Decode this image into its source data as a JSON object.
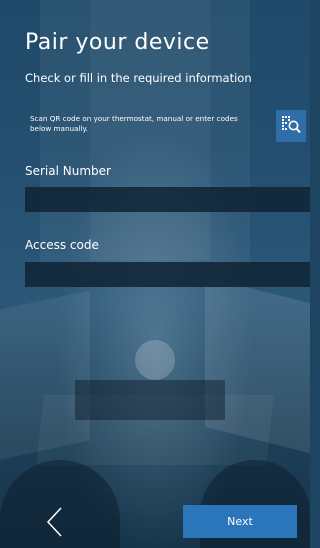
{
  "page": {
    "title": "Pair your device",
    "subtitle": "Check or fill in the required information",
    "scan_instructions": "Scan QR code on your thermostat, manual or enter codes below manually."
  },
  "icons": {
    "qr_scan": "qr-scan-icon",
    "back": "chevron-left-icon"
  },
  "form": {
    "serial_label": "Serial Number",
    "serial_value": "",
    "access_label": "Access code",
    "access_value": ""
  },
  "footer": {
    "next_label": "Next"
  },
  "colors": {
    "accent": "#2b75ba",
    "qr_button": "#2f6ea8",
    "field_bg": "#0f2334"
  }
}
